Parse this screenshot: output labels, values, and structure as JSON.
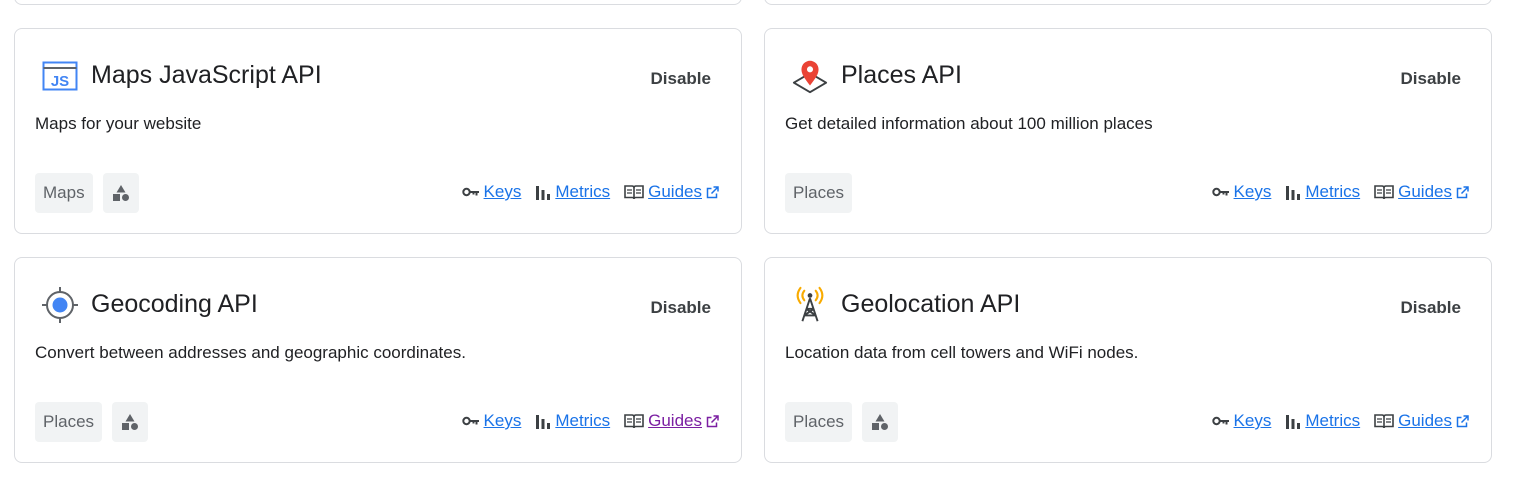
{
  "cards": [
    {
      "title": "Maps JavaScript API",
      "action": "Disable",
      "description": "Maps for your website",
      "chips": [
        "Maps"
      ],
      "icon": "js-icon",
      "links": {
        "keys": "Keys",
        "metrics": "Metrics",
        "guides": "Guides"
      }
    },
    {
      "title": "Places API",
      "action": "Disable",
      "description": "Get detailed information about 100 million places",
      "chips": [
        "Places"
      ],
      "icon": "place-pin-icon",
      "links": {
        "keys": "Keys",
        "metrics": "Metrics",
        "guides": "Guides"
      }
    },
    {
      "title": "Geocoding API",
      "action": "Disable",
      "description": "Convert between addresses and geographic coordinates.",
      "chips": [
        "Places"
      ],
      "icon": "crosshair-icon",
      "links": {
        "keys": "Keys",
        "metrics": "Metrics",
        "guides": "Guides"
      }
    },
    {
      "title": "Geolocation API",
      "action": "Disable",
      "description": "Location data from cell towers and WiFi nodes.",
      "chips": [
        "Places"
      ],
      "icon": "cell-tower-icon",
      "links": {
        "keys": "Keys",
        "metrics": "Metrics",
        "guides": "Guides"
      }
    }
  ],
  "colors": {
    "link": "#1a73e8",
    "visited_link": "#7b1fa2",
    "chip_bg": "#f1f3f4",
    "border": "#dadce0"
  }
}
